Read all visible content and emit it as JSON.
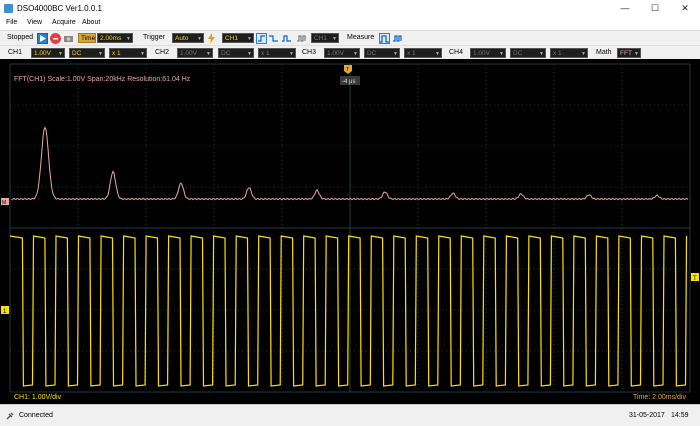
{
  "window": {
    "title": "DSO4000BC Ver1.0.0.1"
  },
  "menu": [
    "File",
    "View",
    "Acquire",
    "About"
  ],
  "toolbar": {
    "state": "Stopped",
    "time_label": "Time",
    "time_value": "2.00ms",
    "trigger_label": "Trigger",
    "trigger_mode": "Auto",
    "trigger_source": "CH1",
    "trigger_source_2": "CH1",
    "measure_label": "Measure"
  },
  "channels": {
    "ch1": {
      "label": "CH1",
      "volts": "1.00V",
      "coupling": "DC",
      "probe": "x 1"
    },
    "ch2": {
      "label": "CH2",
      "volts": "1.00V",
      "coupling": "DC",
      "probe": "x 1"
    },
    "ch3": {
      "label": "CH3",
      "volts": "1.00V",
      "coupling": "DC",
      "probe": "x 1"
    },
    "ch4": {
      "label": "CH4",
      "volts": "1.00V",
      "coupling": "DC",
      "probe": "x 1"
    },
    "math_label": "Math",
    "math_value": "FFT"
  },
  "scope": {
    "fft_info": "FFT(CH1)  Scale:1.00V  Span:20kHz  Resolution:61.04 Hz",
    "trigger_time": "-4 μs",
    "trigger_marker": "T",
    "m_marker": "M",
    "ch1_marker": "1",
    "level_marker": "T",
    "ch1_scale": "CH1: 1.00V/div",
    "timebase": "Time: 2.00ms/div",
    "fft_peaks": [
      {
        "freq_rel": 0.0,
        "amp": 1.0
      },
      {
        "freq_rel": 1.0,
        "amp": 0.38
      },
      {
        "freq_rel": 2.0,
        "amp": 0.22
      },
      {
        "freq_rel": 3.0,
        "amp": 0.16
      },
      {
        "freq_rel": 4.0,
        "amp": 0.12
      },
      {
        "freq_rel": 5.0,
        "amp": 0.1
      },
      {
        "freq_rel": 6.0,
        "amp": 0.08
      },
      {
        "freq_rel": 7.0,
        "amp": 0.07
      },
      {
        "freq_rel": 8.0,
        "amp": 0.06
      },
      {
        "freq_rel": 9.0,
        "amp": 0.05
      }
    ],
    "square_cycles": 30
  },
  "status": {
    "connection": "Connected",
    "date": "31-05-2017",
    "time": "14:59"
  },
  "colors": {
    "fft": "#e8a6ac",
    "ch1": "#ffe100",
    "grid": "#2a4a4a",
    "accent": "#0a64c8"
  }
}
